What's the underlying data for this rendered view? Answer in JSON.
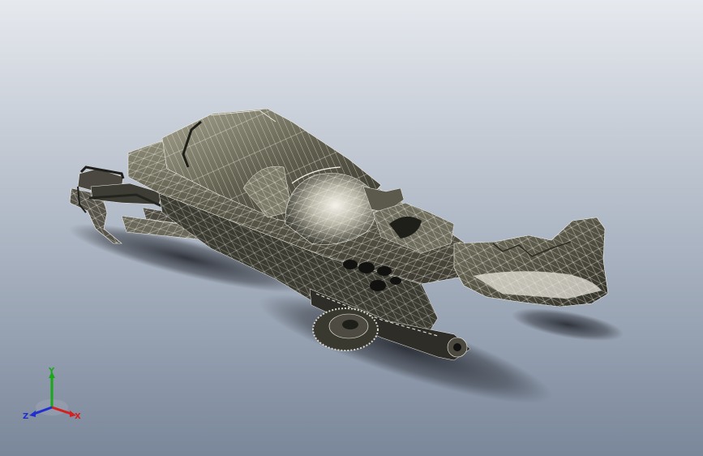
{
  "viewport": {
    "background_top": "#e4e7ec",
    "background_bottom": "#7d8a9c",
    "model_fill": "#5a5848",
    "model_fill_light": "#8c8a78",
    "model_highlight": "#d8d6cc",
    "mesh_color": "#f0efe8",
    "shadow_color": "#2a2d34"
  },
  "triad": {
    "x_label": "X",
    "y_label": "Y",
    "z_label": "Z",
    "x_color": "#d42020",
    "y_color": "#18a818",
    "z_color": "#2030d0"
  }
}
